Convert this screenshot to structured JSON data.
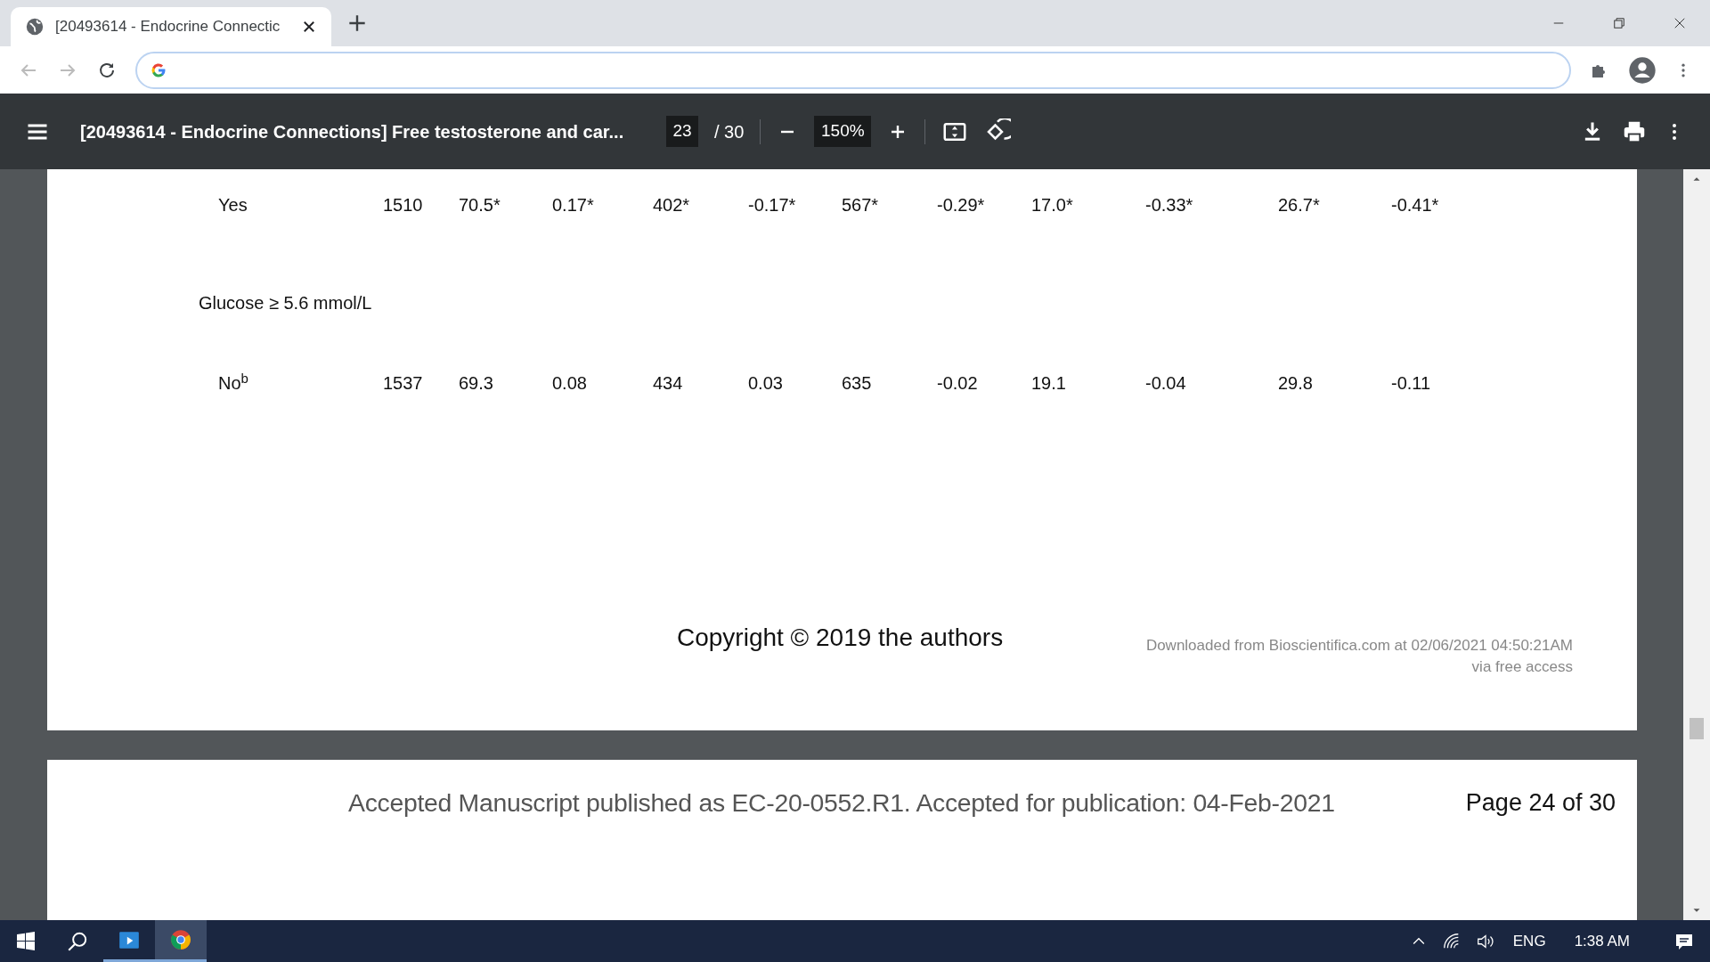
{
  "tabs": [
    {
      "title": "[20493614 - Endocrine Connectic",
      "selected": true
    }
  ],
  "pdf_toolbar": {
    "title": "[20493614 - Endocrine Connections] Free testosterone and car...",
    "page": "23",
    "page_total": "/ 30",
    "zoom": "150%"
  },
  "table": {
    "rows": [
      {
        "kind": "data",
        "label": "Yes",
        "cells": [
          "1510",
          "70.5*",
          "0.17*",
          "402*",
          "-0.17*",
          "567*",
          "-0.29*",
          "17.0*",
          "-0.33*",
          "26.7*",
          "-0.41*"
        ]
      },
      {
        "kind": "heading",
        "label": "Glucose ≥ 5.6 mmol/L"
      },
      {
        "kind": "data",
        "label": "No$^{b}$",
        "cells": [
          "1537",
          "69.3",
          "0.08",
          "434",
          "0.03",
          "635",
          "-0.02",
          "19.1",
          "-0.04",
          "29.8",
          "-0.11"
        ]
      }
    ]
  },
  "page_footer": {
    "copyright": "Copyright © 2019 the authors",
    "download_lines": [
      "Downloaded from Bioscientifica.com at 02/06/2021 04:50:21AM",
      "via free access"
    ]
  },
  "next_page_header": {
    "note": "Accepted Manuscript published as EC-20-0552.R1. Accepted for publication: 04-Feb-2021",
    "page_label": "Page 24 of 30"
  },
  "taskbar": {
    "apps": [
      {
        "kind": "media",
        "active": false
      },
      {
        "kind": "chrome",
        "active": true
      }
    ],
    "language": "ENG",
    "time": "1:38 AM"
  }
}
